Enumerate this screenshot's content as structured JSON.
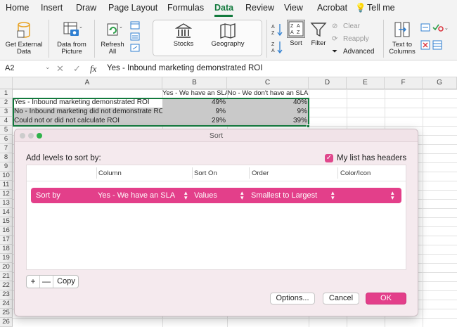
{
  "ribbon_tabs": [
    "Home",
    "Insert",
    "Draw",
    "Page Layout",
    "Formulas",
    "Data",
    "Review",
    "View",
    "Acrobat",
    "Tell me"
  ],
  "active_tab": "Data",
  "ribbon": {
    "get_external": "Get External Data",
    "get_external_l1": "Get External",
    "get_external_l2": "Data",
    "data_picture_l1": "Data from",
    "data_picture_l2": "Picture",
    "refresh_l1": "Refresh",
    "refresh_l2": "All",
    "stocks": "Stocks",
    "geography": "Geography",
    "sort": "Sort",
    "filter": "Filter",
    "clear": "Clear",
    "reapply": "Reapply",
    "advanced": "Advanced",
    "text_columns_l1": "Text to",
    "text_columns_l2": "Columns"
  },
  "formula_bar": {
    "name_box": "A2",
    "fx": "fx",
    "value": "Yes - Inbound marketing demonstrated ROI"
  },
  "columns": [
    "A",
    "B",
    "C",
    "D",
    "E",
    "F",
    "G"
  ],
  "rows": [
    "1",
    "2",
    "3",
    "4",
    "5",
    "6",
    "7",
    "8",
    "9",
    "10",
    "11",
    "12",
    "13",
    "14",
    "15",
    "16",
    "17",
    "18",
    "19",
    "20",
    "21",
    "22",
    "23",
    "24",
    "25",
    "26"
  ],
  "sheet": {
    "header_b": "Yes - We have an SLA",
    "header_c": "No - We don't have an SLA",
    "r2": [
      "Yes - Inbound marketing demonstrated ROI",
      "49%",
      "40%"
    ],
    "r3": [
      "No - Inbound marketing did not demonstrate ROI",
      "9%",
      "9%"
    ],
    "r4": [
      "Could not or did not calculate ROI",
      "29%",
      "39%"
    ]
  },
  "dialog": {
    "title": "Sort",
    "add_levels": "Add levels to sort by:",
    "my_list_headers": "My list has headers",
    "headers_checked": true,
    "col_column": "Column",
    "col_sort_on": "Sort On",
    "col_order": "Order",
    "col_color": "Color/Icon",
    "row_sort_by": "Sort by",
    "row_column": "Yes - We have an SLA",
    "row_sort_on": "Values",
    "row_order": "Smallest to Largest",
    "plus": "+",
    "minus": "—",
    "copy": "Copy",
    "options": "Options...",
    "cancel": "Cancel",
    "ok": "OK"
  },
  "colors": {
    "accent": "#e33f8a",
    "excel_green": "#127a3d"
  }
}
